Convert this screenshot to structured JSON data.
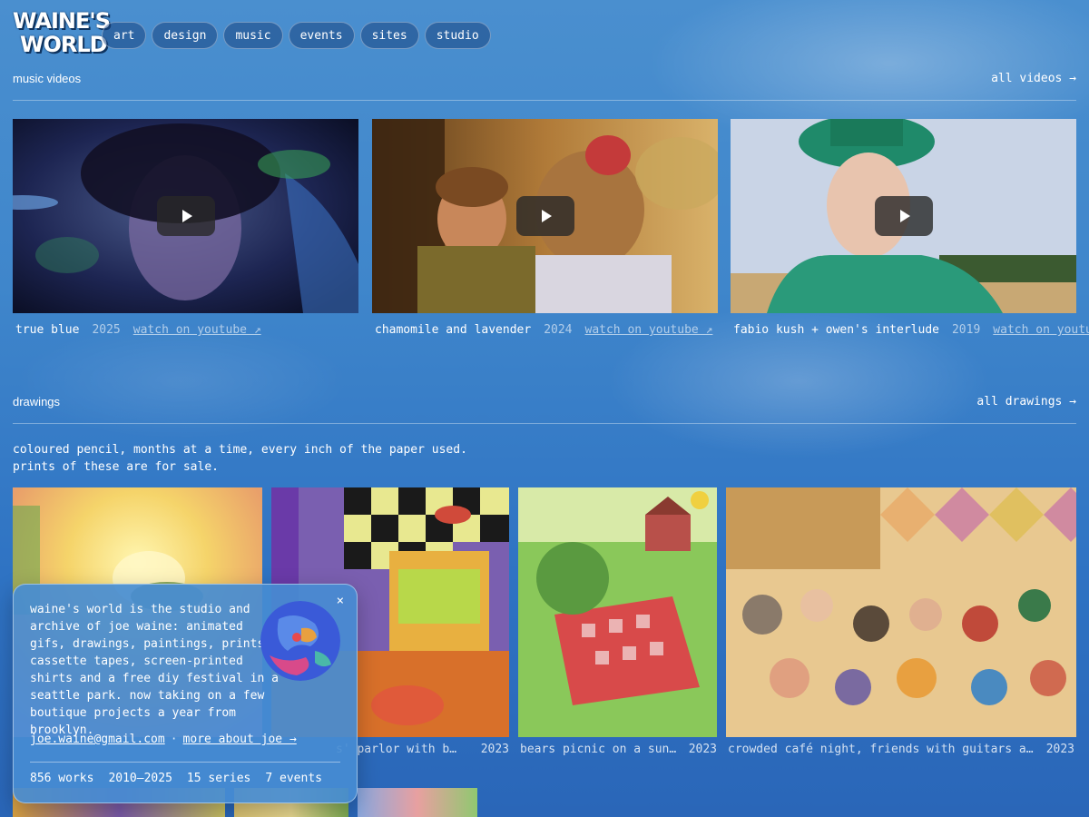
{
  "brand": {
    "logo_line1": "WAINE'S",
    "logo_line2": "WORLD"
  },
  "nav": [
    "art",
    "design",
    "music",
    "events",
    "sites",
    "studio"
  ],
  "music": {
    "title": "music videos",
    "all_link": "all videos →",
    "videos": [
      {
        "title": "true blue",
        "year": "2025",
        "link": "watch on youtube ↗"
      },
      {
        "title": "chamomile and lavender",
        "year": "2024",
        "link": "watch on youtube ↗"
      },
      {
        "title": "fabio kush + owen's interlude",
        "year": "2019",
        "link": "watch on youtube ↗"
      }
    ]
  },
  "drawings": {
    "title": "drawings",
    "all_link": "all drawings →",
    "desc_line1": "coloured pencil, months at a time, every inch of the paper used.",
    "desc_line2": "prints of these are for sale.",
    "items": [
      {
        "title": "",
        "year": ""
      },
      {
        "title": "s' parlor with b…",
        "year": "2023"
      },
      {
        "title": "bears picnic on a sunny …",
        "year": "2023"
      },
      {
        "title": "crowded café night, friends with guitars and ga…",
        "year": "2023"
      }
    ]
  },
  "about": {
    "text": "waine's world is the studio and archive of joe waine: animated gifs, drawings, paintings, prints, cassette tapes, screen-printed shirts and a free diy festival in a seattle park. now taking on a few boutique projects a year from brooklyn.",
    "email": "joe.waine@gmail.com",
    "sep": "·",
    "more": "more about joe →",
    "close": "×",
    "stats": [
      "856 works",
      "2010–2025",
      "15 series",
      "7 events"
    ]
  }
}
